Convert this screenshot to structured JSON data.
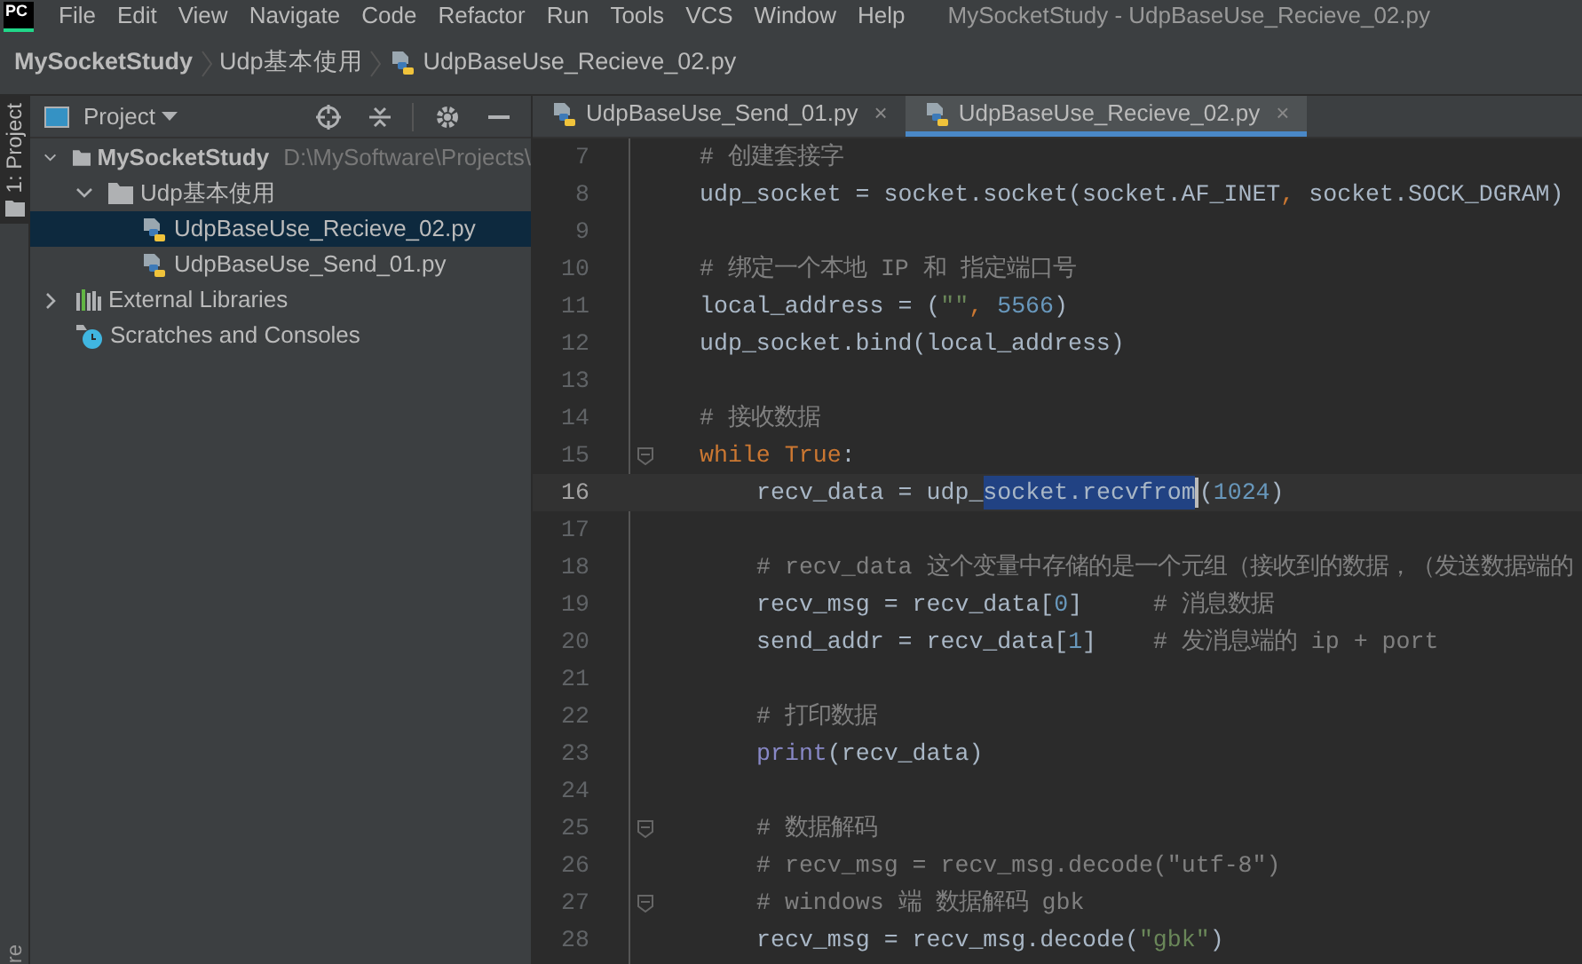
{
  "app_logo": "PC",
  "menu": [
    "File",
    "Edit",
    "View",
    "Navigate",
    "Code",
    "Refactor",
    "Run",
    "Tools",
    "VCS",
    "Window",
    "Help"
  ],
  "window": {
    "title": "MySocketStudy - UdpBaseUse_Recieve_02.py"
  },
  "breadcrumb": [
    {
      "label": "MySocketStudy",
      "kind": "project"
    },
    {
      "label": "Udp基本使用",
      "kind": "folder"
    },
    {
      "label": "UdpBaseUse_Recieve_02.py",
      "kind": "file"
    }
  ],
  "side_strip": {
    "top": "1: Project",
    "bottom": "re"
  },
  "project_panel": {
    "title": "Project",
    "tree": [
      {
        "label": "MySocketStudy",
        "path": "D:\\MySoftware\\Projects\\",
        "kind": "folder",
        "expanded": true,
        "selected": false,
        "children": [
          {
            "label": "Udp基本使用",
            "kind": "folder",
            "expanded": true,
            "selected": false,
            "children": [
              {
                "label": "UdpBaseUse_Recieve_02.py",
                "kind": "python",
                "selected": true
              },
              {
                "label": "UdpBaseUse_Send_01.py",
                "kind": "python",
                "selected": false
              }
            ]
          }
        ]
      },
      {
        "label": "External Libraries",
        "kind": "library",
        "expanded": false,
        "selected": false
      },
      {
        "label": "Scratches and Consoles",
        "kind": "scratch",
        "selected": false
      }
    ]
  },
  "tabs": [
    {
      "label": "UdpBaseUse_Send_01.py",
      "close": "×",
      "selected": false
    },
    {
      "label": "UdpBaseUse_Recieve_02.py",
      "close": "×",
      "selected": true
    }
  ],
  "code": [
    {
      "number": "7",
      "tokens": [
        {
          "kind": "comment",
          "text": "# 创建套接字"
        }
      ]
    },
    {
      "number": "8",
      "tokens": [
        {
          "kind": "plain",
          "text": "udp_socket = socket.socket(socket.AF_INET"
        },
        {
          "kind": "kw",
          "text": ","
        },
        {
          "kind": "plain",
          "text": " socket.SOCK_DGRAM)"
        }
      ]
    },
    {
      "number": "9"
    },
    {
      "number": "10",
      "tokens": [
        {
          "kind": "comment",
          "text": "# 绑定一个本地 IP 和 指定端口号"
        }
      ]
    },
    {
      "number": "11",
      "tokens": [
        {
          "kind": "plain",
          "text": "local_address = ("
        },
        {
          "kind": "str",
          "text": "\"\""
        },
        {
          "kind": "kw",
          "text": ","
        },
        {
          "kind": "num",
          "text": " 5566"
        },
        {
          "kind": "plain",
          "text": ")"
        }
      ]
    },
    {
      "number": "12",
      "tokens": [
        {
          "kind": "plain",
          "text": "udp_socket.bind(local_address)"
        }
      ]
    },
    {
      "number": "13"
    },
    {
      "number": "14",
      "tokens": [
        {
          "kind": "comment",
          "text": "# 接收数据"
        }
      ]
    },
    {
      "number": "15",
      "fold": true,
      "tokens": [
        {
          "kind": "kw",
          "text": "while True"
        },
        {
          "kind": "plain",
          "text": ":"
        }
      ],
      "children": [
        {
          "number": "16",
          "current": true,
          "tokens": [
            {
              "kind": "plain",
              "text": "recv_data = udp_"
            },
            {
              "kind": "selection",
              "text": "socket.recvfrom"
            },
            {
              "kind": "caret"
            },
            {
              "kind": "plain",
              "text": "("
            },
            {
              "kind": "num",
              "text": "1024"
            },
            {
              "kind": "plain",
              "text": ")"
            }
          ]
        },
        {
          "number": "17"
        },
        {
          "number": "18",
          "tokens": [
            {
              "kind": "comment",
              "text": "# recv_data 这个变量中存储的是一个元组（接收到的数据，（发送数据端的"
            }
          ]
        },
        {
          "number": "19",
          "tokens": [
            {
              "kind": "plain",
              "text": "recv_msg = recv_data["
            },
            {
              "kind": "num",
              "text": "0"
            },
            {
              "kind": "plain",
              "text": "]     "
            },
            {
              "kind": "comment",
              "text": "# 消息数据"
            }
          ]
        },
        {
          "number": "20",
          "tokens": [
            {
              "kind": "plain",
              "text": "send_addr = recv_data["
            },
            {
              "kind": "num",
              "text": "1"
            },
            {
              "kind": "plain",
              "text": "]    "
            },
            {
              "kind": "comment",
              "text": "# 发消息端的 ip + port"
            }
          ]
        },
        {
          "number": "21"
        },
        {
          "number": "22",
          "tokens": [
            {
              "kind": "comment",
              "text": "# 打印数据"
            }
          ]
        },
        {
          "number": "23",
          "tokens": [
            {
              "kind": "builtin",
              "text": "print"
            },
            {
              "kind": "plain",
              "text": "(recv_data)"
            }
          ]
        },
        {
          "number": "24"
        },
        {
          "number": "25",
          "fold": true,
          "tokens": [
            {
              "kind": "comment",
              "text": "# 数据解码"
            }
          ]
        },
        {
          "number": "26",
          "tokens": [
            {
              "kind": "comment",
              "text": "# recv_msg = recv_msg.decode(\"utf-8\")"
            }
          ]
        },
        {
          "number": "27",
          "fold": true,
          "tokens": [
            {
              "kind": "comment",
              "text": "# windows 端 数据解码 gbk"
            }
          ]
        },
        {
          "number": "28",
          "tokens": [
            {
              "kind": "plain",
              "text": "recv_msg = recv_msg.decode("
            },
            {
              "kind": "str",
              "text": "\"gbk\""
            },
            {
              "kind": "plain",
              "text": ")"
            }
          ]
        }
      ]
    }
  ]
}
